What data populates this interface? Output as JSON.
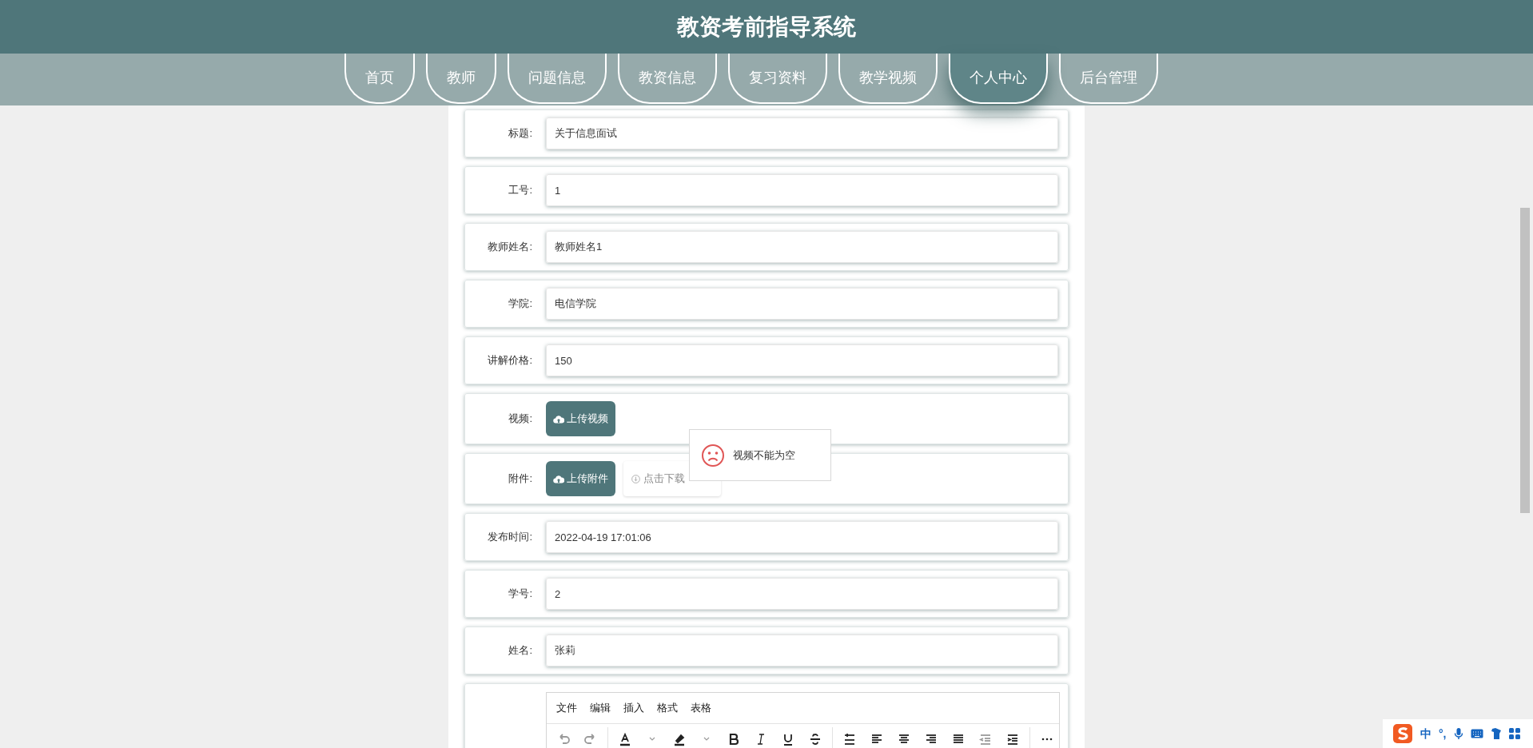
{
  "header": {
    "title": "教资考前指导系统"
  },
  "nav": [
    {
      "label": "首页",
      "selected": false
    },
    {
      "label": "教师",
      "selected": false
    },
    {
      "label": "问题信息",
      "selected": false
    },
    {
      "label": "教资信息",
      "selected": false
    },
    {
      "label": "复习资料",
      "selected": false
    },
    {
      "label": "教学视频",
      "selected": false
    },
    {
      "label": "个人中心",
      "selected": true
    },
    {
      "label": "后台管理",
      "selected": false
    }
  ],
  "form": [
    {
      "kind": "text",
      "label": "标题:",
      "value": "关于信息面试"
    },
    {
      "kind": "text",
      "label": "工号:",
      "value": "1"
    },
    {
      "kind": "text",
      "label": "教师姓名:",
      "value": "教师姓名1"
    },
    {
      "kind": "text",
      "label": "学院:",
      "value": "电信学院"
    },
    {
      "kind": "text",
      "label": "讲解价格:",
      "value": "150"
    },
    {
      "kind": "upload",
      "label": "视频:",
      "button": "上传视频"
    },
    {
      "kind": "upload",
      "label": "附件:",
      "button": "上传附件",
      "download": "点击下载"
    },
    {
      "kind": "text",
      "label": "发布时间:",
      "value": "2022-04-19 17:01:06"
    },
    {
      "kind": "text",
      "label": "学号:",
      "value": "2"
    },
    {
      "kind": "text",
      "label": "姓名:",
      "value": "张莉"
    }
  ],
  "editor": {
    "menu": [
      "文件",
      "编辑",
      "插入",
      "格式",
      "表格"
    ]
  },
  "toast": {
    "message": "视频不能为空"
  },
  "ime": {
    "mode": "中",
    "punctuation": "°,"
  }
}
